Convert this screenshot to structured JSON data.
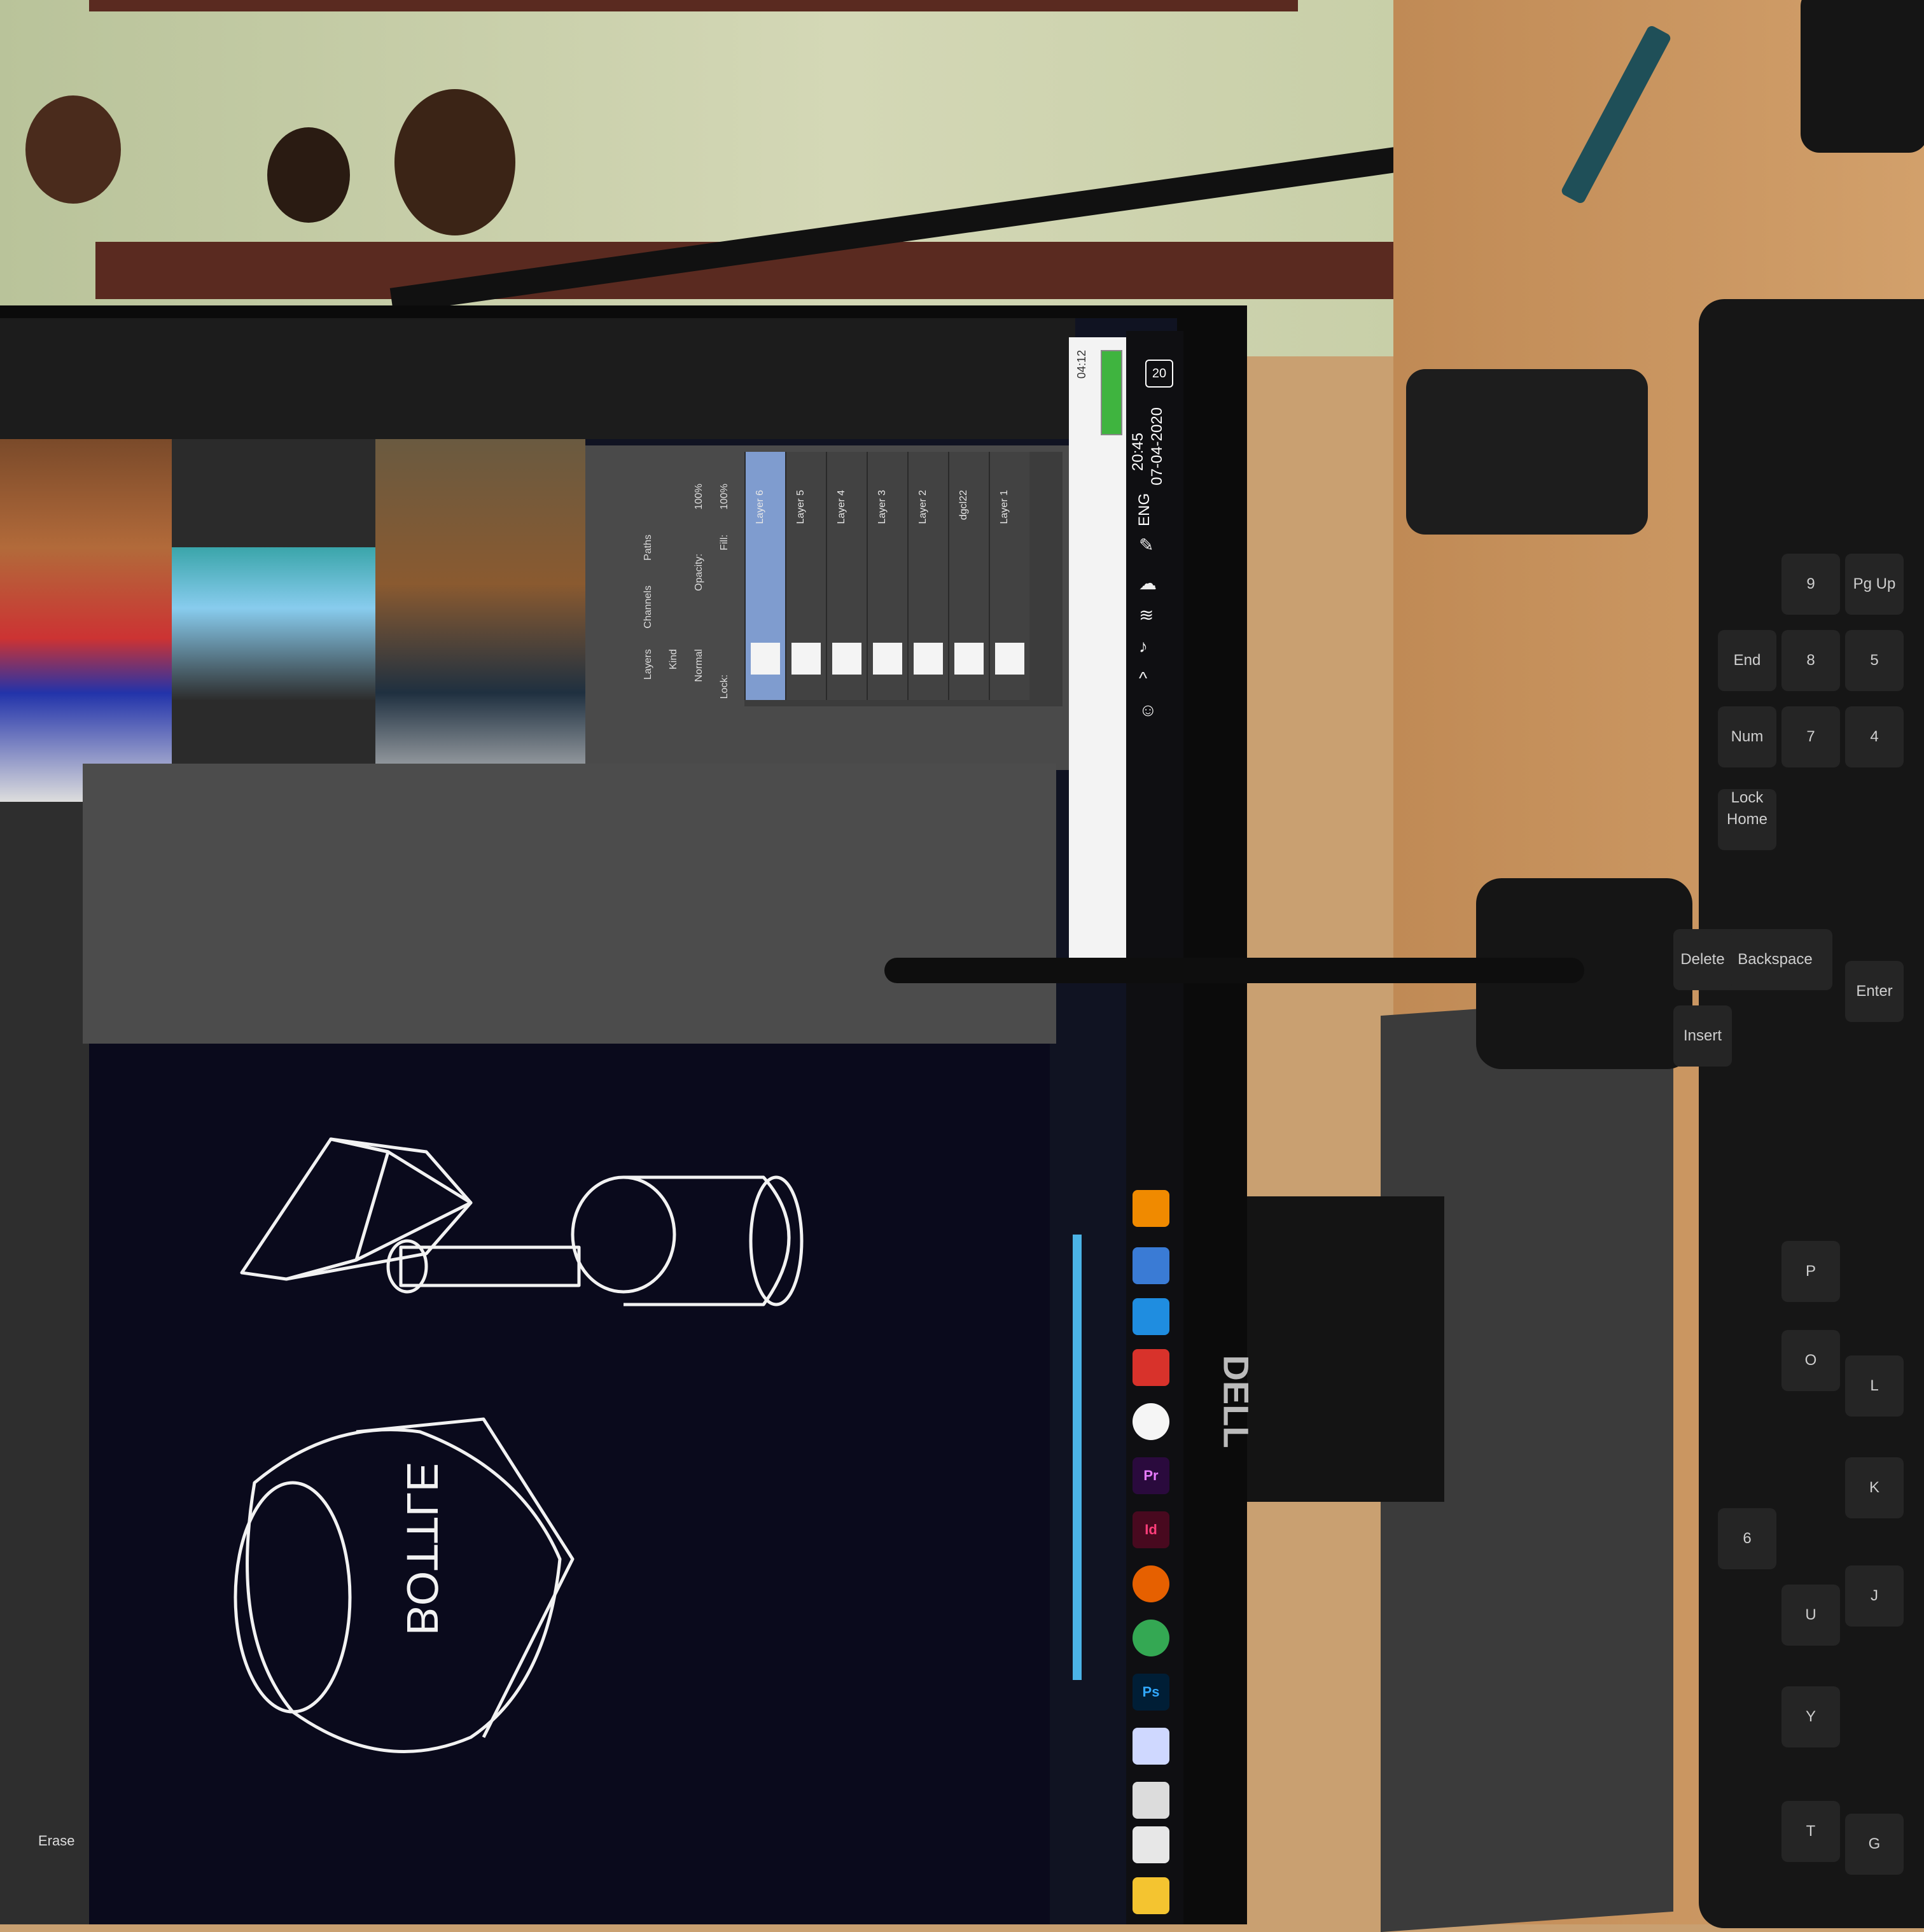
{
  "taskbar": {
    "time": "20:45",
    "date": "07-04-2020",
    "language": "ENG",
    "notification_count": "20",
    "apps": [
      {
        "name": "vlc",
        "label": ""
      },
      {
        "name": "photos",
        "label": ""
      },
      {
        "name": "outlook",
        "label": ""
      },
      {
        "name": "app-red",
        "label": ""
      },
      {
        "name": "app-white",
        "label": ""
      },
      {
        "name": "premiere",
        "label": "Pr"
      },
      {
        "name": "indesign",
        "label": "Id"
      },
      {
        "name": "firefox",
        "label": ""
      },
      {
        "name": "chrome",
        "label": ""
      },
      {
        "name": "photoshop",
        "label": "Ps"
      },
      {
        "name": "app-paint",
        "label": ""
      },
      {
        "name": "calculator",
        "label": ""
      },
      {
        "name": "store",
        "label": ""
      },
      {
        "name": "file-explorer",
        "label": ""
      }
    ]
  },
  "call_panel": {
    "timer": "04:12"
  },
  "photoshop": {
    "tabs": [
      "Layers",
      "Channels",
      "Paths"
    ],
    "kind_label": "Kind",
    "blend_mode": "Normal",
    "opacity_label": "Opacity:",
    "opacity_value": "100%",
    "fill_label": "Fill:",
    "fill_value": "100%",
    "lock_label": "Lock:",
    "layers": [
      "Layer 6",
      "Layer 5",
      "Layer 4",
      "Layer 3",
      "Layer 2",
      "dgcl22",
      "Layer 1"
    ],
    "tool_label": "Erase"
  },
  "sketch": {
    "text": "BOTTLE"
  },
  "monitor": {
    "brand": "DELL"
  },
  "keyboard": {
    "keys": [
      "Home",
      "Num Lock",
      "7",
      "8",
      "9",
      "Pg Up",
      "End",
      "Backspace",
      "Delete",
      "Insert",
      "Enter",
      "P",
      "O",
      "L",
      "K",
      "J",
      "U",
      "Y",
      "T",
      "G",
      "6",
      "5",
      "4"
    ]
  }
}
